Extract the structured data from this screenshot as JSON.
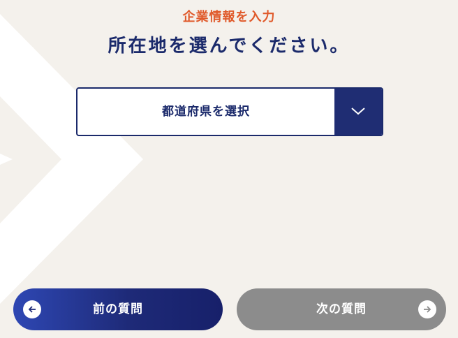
{
  "header": {
    "step_label": "企業情報を入力",
    "question": "所在地を選んでください。"
  },
  "prefecture_select": {
    "selected_text": "都道府県を選択",
    "arrow_icon": "chevron-down-icon"
  },
  "navigation": {
    "prev_label": "前の質問",
    "prev_icon": "arrow-left-icon",
    "next_label": "次の質問",
    "next_icon": "arrow-right-icon"
  },
  "colors": {
    "accent_orange": "#e05a2b",
    "navy": "#1b2a6b",
    "background": "#f4f1ec",
    "disabled_gray": "#8c8c8c"
  }
}
